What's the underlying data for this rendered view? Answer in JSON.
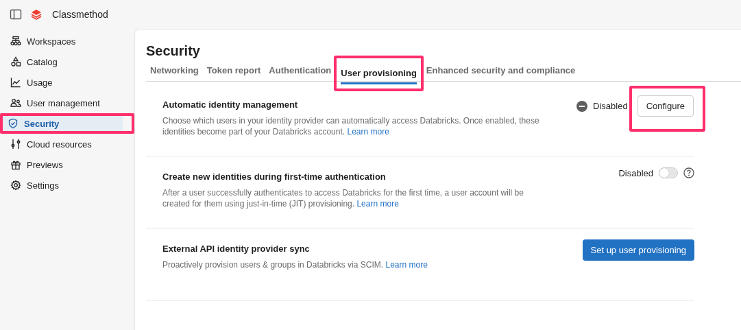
{
  "header": {
    "org_name": "Classmethod"
  },
  "sidebar": {
    "items": [
      {
        "label": "Workspaces",
        "kind": "workspaces",
        "selected": false,
        "highlighted": false
      },
      {
        "label": "Catalog",
        "kind": "catalog",
        "selected": false,
        "highlighted": false
      },
      {
        "label": "Usage",
        "kind": "usage",
        "selected": false,
        "highlighted": false
      },
      {
        "label": "User management",
        "kind": "users",
        "selected": false,
        "highlighted": false
      },
      {
        "label": "Security",
        "kind": "shield",
        "selected": true,
        "highlighted": true
      },
      {
        "label": "Cloud resources",
        "kind": "sliders",
        "selected": false,
        "highlighted": false
      },
      {
        "label": "Previews",
        "kind": "gift",
        "selected": false,
        "highlighted": false
      },
      {
        "label": "Settings",
        "kind": "gear",
        "selected": false,
        "highlighted": false
      }
    ]
  },
  "page": {
    "title": "Security",
    "tabs": [
      {
        "label": "Networking",
        "selected": false,
        "highlighted": false
      },
      {
        "label": "Token report",
        "selected": false,
        "highlighted": false
      },
      {
        "label": "Authentication",
        "selected": false,
        "highlighted": false
      },
      {
        "label": "User provisioning",
        "selected": true,
        "highlighted": true
      },
      {
        "label": "Enhanced security and compliance",
        "selected": false,
        "highlighted": false
      }
    ],
    "settings": [
      {
        "kind": "status",
        "title": "Automatic identity management",
        "description": "Choose which users in your identity provider can automatically access Databricks. Once enabled, these identities become part of your Databricks account.",
        "link": "Learn more",
        "status": "Disabled",
        "button": "Configure",
        "highlighted": true
      },
      {
        "kind": "toggle",
        "title": "Create new identities during first-time authentication",
        "description": "After a user successfully authenticates to access Databricks for the first time, a user account will be created for them using just-in-time (JIT) provisioning.",
        "link": "Learn more",
        "status": "Disabled",
        "on": false
      },
      {
        "kind": "action",
        "title": "External API identity provider sync",
        "description": "Proactively provision users & groups in Databricks via SCIM.",
        "link": "Learn more",
        "button": "Set up user provisioning"
      }
    ]
  }
}
